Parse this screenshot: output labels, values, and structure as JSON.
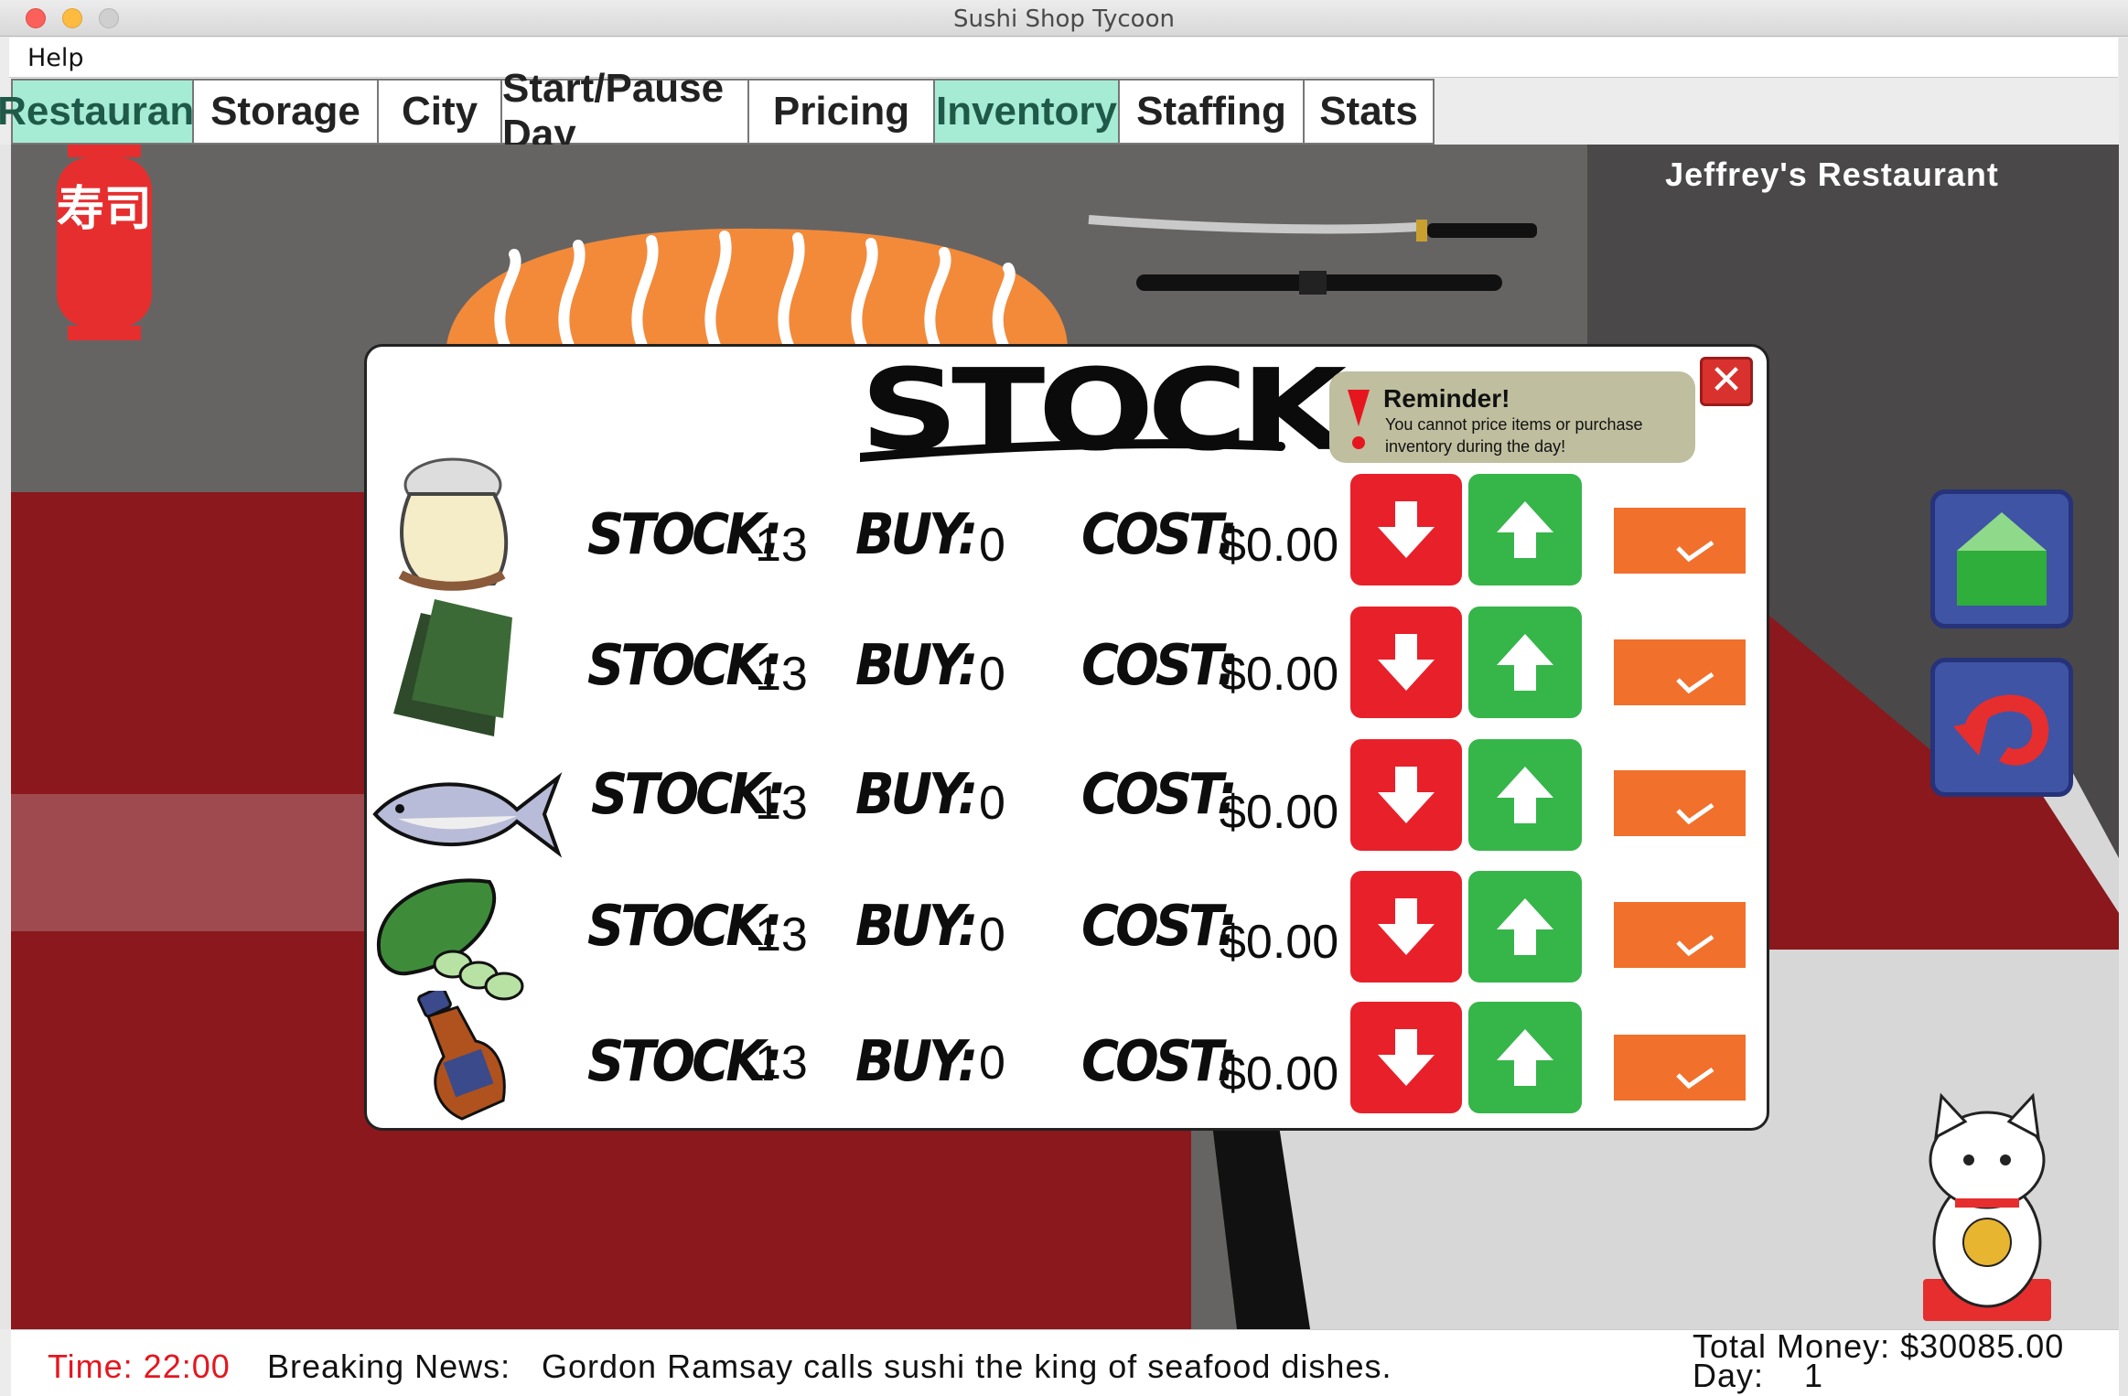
{
  "window": {
    "title": "Sushi Shop Tycoon"
  },
  "menu": {
    "help": "Help"
  },
  "tabs": [
    {
      "label": "Restaurant",
      "active": true
    },
    {
      "label": "Storage",
      "active": false
    },
    {
      "label": "City",
      "active": false
    },
    {
      "label": "Start/Pause Day",
      "active": false
    },
    {
      "label": "Pricing",
      "active": false
    },
    {
      "label": "Inventory",
      "active": true
    },
    {
      "label": "Staffing",
      "active": false
    },
    {
      "label": "Stats",
      "active": false
    }
  ],
  "restaurant": {
    "name": "Jeffrey's Restaurant",
    "lantern_text": "寿司"
  },
  "dialog": {
    "title": "STOCK",
    "reminder_title": "Reminder!",
    "reminder_body": "You cannot price items or purchase inventory during the day!",
    "stock_label": "STOCK:",
    "buy_label": "BUY:",
    "cost_label": "COST:",
    "items": [
      {
        "icon": "rice-sack-icon",
        "stock": "13",
        "buy": "0",
        "cost": "$0.00"
      },
      {
        "icon": "seaweed-icon",
        "stock": "13",
        "buy": "0",
        "cost": "$0.00"
      },
      {
        "icon": "fish-icon",
        "stock": "13",
        "buy": "0",
        "cost": "$0.00"
      },
      {
        "icon": "cucumber-icon",
        "stock": "13",
        "buy": "0",
        "cost": "$0.00"
      },
      {
        "icon": "soy-sauce-icon",
        "stock": "13",
        "buy": "0",
        "cost": "$0.00"
      }
    ]
  },
  "status": {
    "time": "Time: 22:00",
    "news_label": "Breaking News:",
    "news": "Gordon Ramsay calls sushi the king of seafood dishes.",
    "money": "Total Money: $30085.00",
    "day_label": "Day:",
    "day": "1"
  },
  "colors": {
    "tab_active": "#a6ecd5",
    "down": "#e8202a",
    "up": "#36b549",
    "confirm": "#f0702c",
    "floor": "#8b181c"
  }
}
